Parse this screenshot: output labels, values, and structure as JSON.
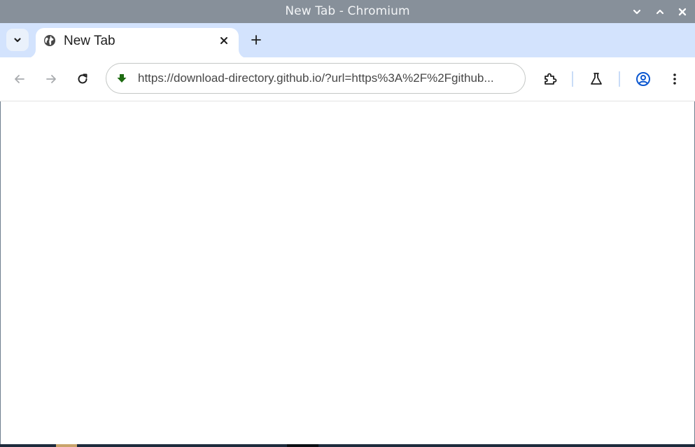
{
  "window": {
    "title": "New Tab - Chromium"
  },
  "tabs": [
    {
      "title": "New Tab",
      "favicon": "globe-icon",
      "active": true
    }
  ],
  "toolbar": {
    "url": "https://download-directory.github.io/?url=https%3A%2F%2Fgithub...",
    "site_icon": "download-arrow-icon",
    "back_enabled": false,
    "forward_enabled": false
  },
  "colors": {
    "titlebar": "#87909a",
    "tabstrip": "#d3e3fd",
    "accent": "#0b57d0",
    "site_icon": "#1e6b12"
  },
  "icons": {
    "window_controls": [
      "chevron-down-icon",
      "chevron-up-icon",
      "close-icon"
    ],
    "toolbar_right": [
      "extensions-icon",
      "labs-flask-icon",
      "profile-icon",
      "more-vertical-icon"
    ]
  }
}
